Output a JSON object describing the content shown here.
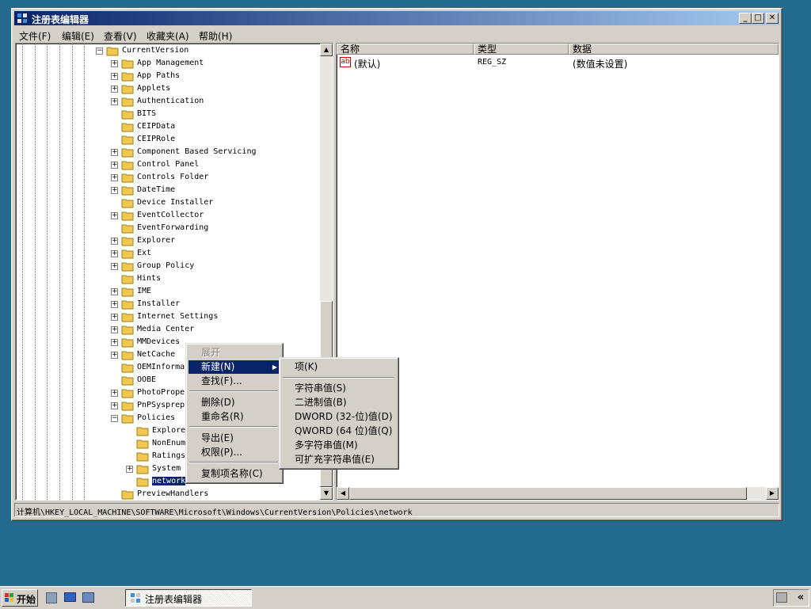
{
  "window": {
    "title": "注册表编辑器",
    "controls": {
      "minimize": "_",
      "maximize": "□",
      "close": "✕"
    }
  },
  "menubar": [
    "文件(F)",
    "编辑(E)",
    "查看(V)",
    "收藏夹(A)",
    "帮助(H)"
  ],
  "tree": {
    "parent": {
      "label": "CurrentVersion",
      "state": "expanded"
    },
    "children": [
      {
        "label": "App Management",
        "expandable": true
      },
      {
        "label": "App Paths",
        "expandable": true
      },
      {
        "label": "Applets",
        "expandable": true
      },
      {
        "label": "Authentication",
        "expandable": true
      },
      {
        "label": "BITS",
        "expandable": false
      },
      {
        "label": "CEIPData",
        "expandable": false
      },
      {
        "label": "CEIPRole",
        "expandable": false
      },
      {
        "label": "Component Based Servicing",
        "expandable": true
      },
      {
        "label": "Control Panel",
        "expandable": true
      },
      {
        "label": "Controls Folder",
        "expandable": true
      },
      {
        "label": "DateTime",
        "expandable": true
      },
      {
        "label": "Device Installer",
        "expandable": false
      },
      {
        "label": "EventCollector",
        "expandable": true
      },
      {
        "label": "EventForwarding",
        "expandable": false
      },
      {
        "label": "Explorer",
        "expandable": true
      },
      {
        "label": "Ext",
        "expandable": true
      },
      {
        "label": "Group Policy",
        "expandable": true
      },
      {
        "label": "Hints",
        "expandable": false
      },
      {
        "label": "IME",
        "expandable": true
      },
      {
        "label": "Installer",
        "expandable": true
      },
      {
        "label": "Internet Settings",
        "expandable": true
      },
      {
        "label": "Media Center",
        "expandable": true
      },
      {
        "label": "MMDevices",
        "expandable": true
      },
      {
        "label": "NetCache",
        "expandable": true
      },
      {
        "label": "OEMInforma",
        "expandable": false
      },
      {
        "label": "OOBE",
        "expandable": false
      },
      {
        "label": "PhotoPrope",
        "expandable": true
      },
      {
        "label": "PnPSysprep",
        "expandable": true
      },
      {
        "label": "Policies",
        "expandable": true,
        "expanded": true
      }
    ],
    "policies_children": [
      {
        "label": "Explore",
        "expandable": false
      },
      {
        "label": "NonEnum",
        "expandable": false
      },
      {
        "label": "Ratings",
        "expandable": false
      },
      {
        "label": "System",
        "expandable": true
      },
      {
        "label": "network",
        "expandable": false,
        "selected": true
      }
    ],
    "after": {
      "label": "PreviewHandlers",
      "expandable": false
    }
  },
  "list": {
    "columns": [
      "名称",
      "类型",
      "数据"
    ],
    "rows": [
      {
        "icon": "ab",
        "name": "(默认)",
        "type": "REG_SZ",
        "data": "(数值未设置)"
      }
    ]
  },
  "context_menu": {
    "items": [
      {
        "label": "展开",
        "disabled": true
      },
      {
        "label": "新建(N)",
        "highlighted": true,
        "submenu": true
      },
      {
        "label": "查找(F)..."
      },
      {
        "label": "删除(D)"
      },
      {
        "label": "重命名(R)"
      },
      {
        "label": "导出(E)"
      },
      {
        "label": "权限(P)..."
      },
      {
        "label": "复制项名称(C)"
      }
    ],
    "submenu_arrow": "▶"
  },
  "submenu": {
    "items": [
      "项(K)",
      "字符串值(S)",
      "二进制值(B)",
      "DWORD (32-位)值(D)",
      "QWORD (64 位)值(Q)",
      "多字符串值(M)",
      "可扩充字符串值(E)"
    ]
  },
  "statusbar": {
    "path": "计算机\\HKEY_LOCAL_MACHINE\\SOFTWARE\\Microsoft\\Windows\\CurrentVersion\\Policies\\network"
  },
  "taskbar": {
    "start_label": "开始",
    "active_task": "注册表编辑器",
    "tray_toggle": "«"
  },
  "colors": {
    "desktop": "#236b8e",
    "title_active": "#0a246a",
    "selection": "#0a246a",
    "folder": "#f0c850"
  }
}
